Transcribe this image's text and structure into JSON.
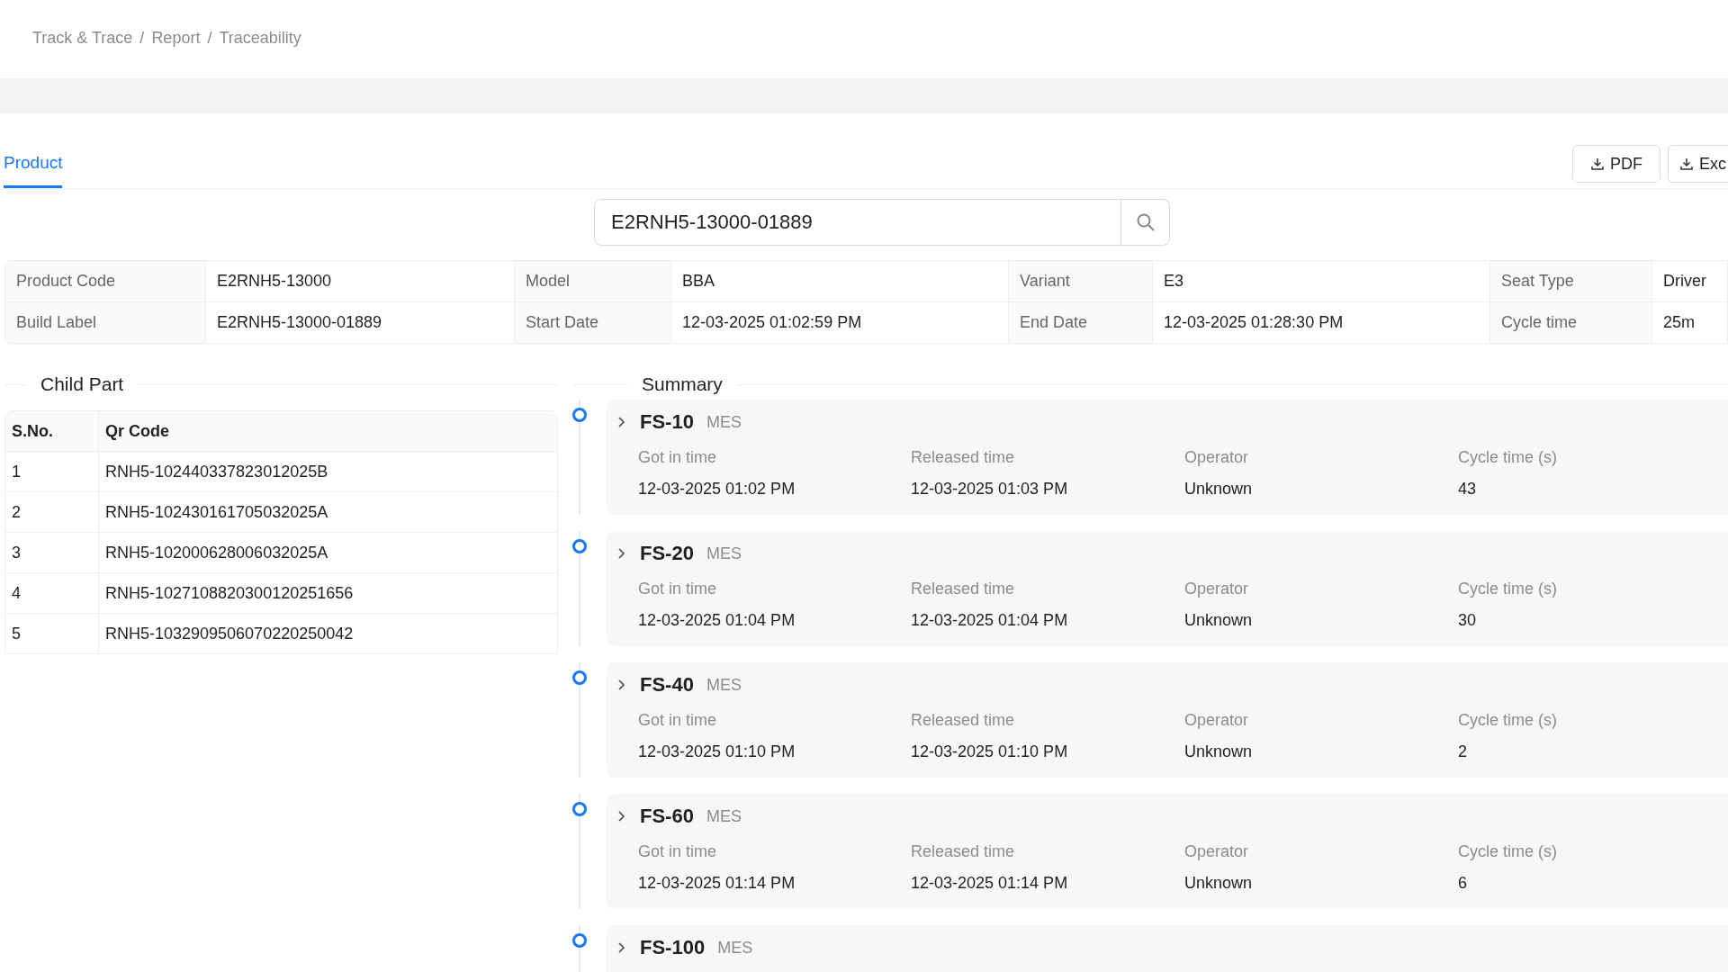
{
  "breadcrumb": {
    "items": [
      "Track & Trace",
      "Report",
      "Traceability"
    ],
    "separator": "/"
  },
  "tabs": [
    {
      "label": "Product",
      "selected": true
    }
  ],
  "export_buttons": [
    "PDF",
    "Exc"
  ],
  "search": {
    "value": "E2RNH5-13000-01889"
  },
  "product_info": [
    [
      {
        "label": "Product Code",
        "value": "E2RNH5-13000"
      },
      {
        "label": "Model",
        "value": "BBA"
      },
      {
        "label": "Variant",
        "value": "E3"
      },
      {
        "label": "Seat Type",
        "value": "Driver"
      }
    ],
    [
      {
        "label": "Build Label",
        "value": "E2RNH5-13000-01889"
      },
      {
        "label": "Start Date",
        "value": "12-03-2025 01:02:59 PM"
      },
      {
        "label": "End Date",
        "value": "12-03-2025 01:28:30 PM"
      },
      {
        "label": "Cycle time",
        "value": "25m"
      }
    ]
  ],
  "child_part": {
    "title": "Child Part",
    "columns": [
      "S.No.",
      "Qr Code"
    ],
    "rows": [
      [
        "1",
        "RNH5-102440337823012025B"
      ],
      [
        "2",
        "RNH5-102430161705032025A"
      ],
      [
        "3",
        "RNH5-102000628006032025A"
      ],
      [
        "4",
        "RNH5-1027108820300120251656"
      ],
      [
        "5",
        "RNH5-1032909506070220250042"
      ]
    ]
  },
  "summary": {
    "title": "Summary",
    "stations": [
      {
        "name": "FS-10",
        "source": "MES",
        "fields": [
          {
            "label": "Got in time",
            "value": "12-03-2025 01:02 PM"
          },
          {
            "label": "Released time",
            "value": "12-03-2025 01:03 PM"
          },
          {
            "label": "Operator",
            "value": "Unknown"
          },
          {
            "label": "Cycle time (s)",
            "value": "43"
          }
        ]
      },
      {
        "name": "FS-20",
        "source": "MES",
        "fields": [
          {
            "label": "Got in time",
            "value": "12-03-2025 01:04 PM"
          },
          {
            "label": "Released time",
            "value": "12-03-2025 01:04 PM"
          },
          {
            "label": "Operator",
            "value": "Unknown"
          },
          {
            "label": "Cycle time (s)",
            "value": "30"
          }
        ]
      },
      {
        "name": "FS-40",
        "source": "MES",
        "fields": [
          {
            "label": "Got in time",
            "value": "12-03-2025 01:10 PM"
          },
          {
            "label": "Released time",
            "value": "12-03-2025 01:10 PM"
          },
          {
            "label": "Operator",
            "value": "Unknown"
          },
          {
            "label": "Cycle time (s)",
            "value": "2"
          }
        ]
      },
      {
        "name": "FS-60",
        "source": "MES",
        "fields": [
          {
            "label": "Got in time",
            "value": "12-03-2025 01:14 PM"
          },
          {
            "label": "Released time",
            "value": "12-03-2025 01:14 PM"
          },
          {
            "label": "Operator",
            "value": "Unknown"
          },
          {
            "label": "Cycle time (s)",
            "value": "6"
          }
        ]
      },
      {
        "name": "FS-100",
        "source": "MES"
      }
    ]
  }
}
